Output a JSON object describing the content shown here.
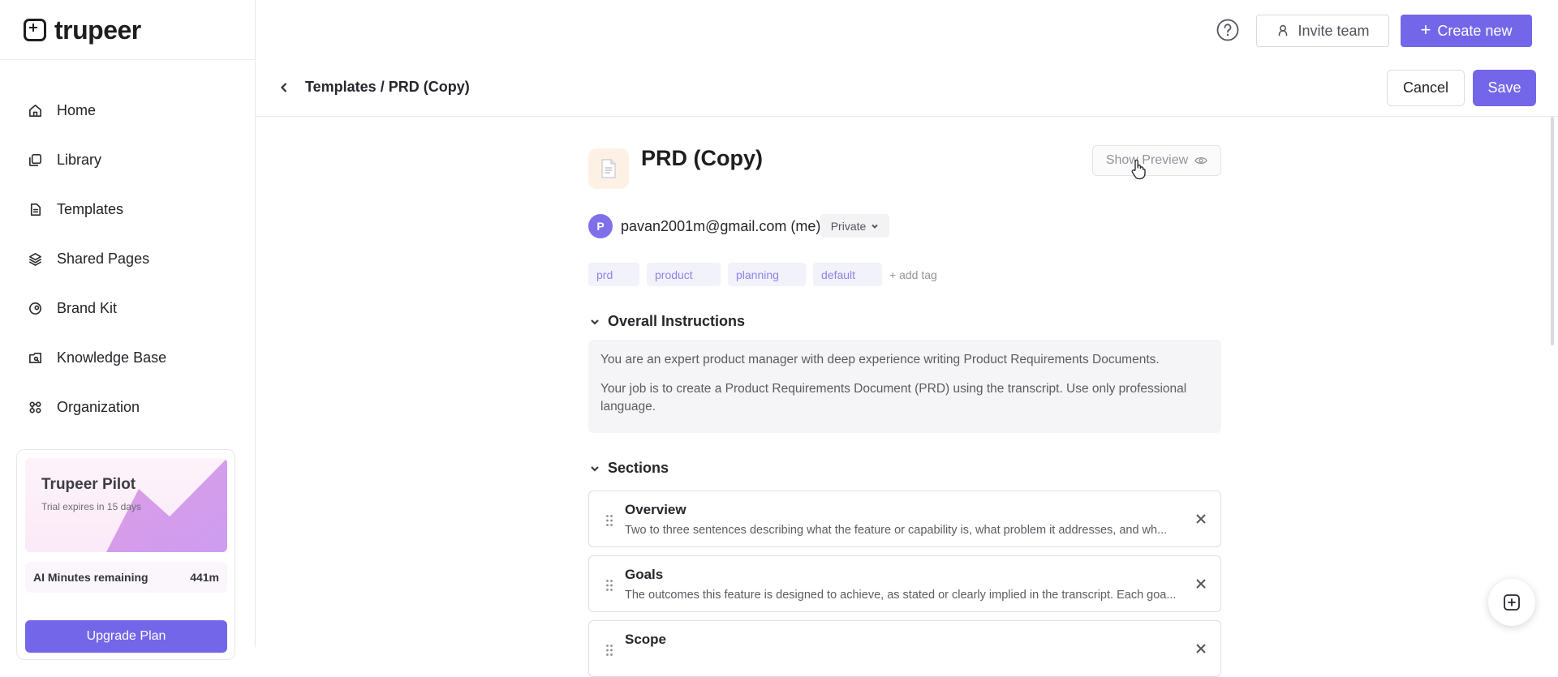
{
  "app": {
    "brand_name": "trupeer",
    "accent_color": "#7366e8"
  },
  "sidebar": {
    "items": [
      {
        "label": "Home",
        "icon": "home-icon"
      },
      {
        "label": "Library",
        "icon": "library-icon"
      },
      {
        "label": "Templates",
        "icon": "templates-icon"
      },
      {
        "label": "Shared Pages",
        "icon": "shared-pages-icon"
      },
      {
        "label": "Brand Kit",
        "icon": "brand-kit-icon"
      },
      {
        "label": "Knowledge Base",
        "icon": "knowledge-base-icon"
      },
      {
        "label": "Organization",
        "icon": "organization-icon"
      }
    ],
    "pilot": {
      "title": "Trupeer Pilot",
      "trial_text": "Trial expires in 15 days",
      "minutes_label": "AI Minutes remaining",
      "minutes_value": "441m",
      "upgrade_label": "Upgrade Plan"
    }
  },
  "topbar": {
    "help_icon": "help-icon",
    "invite_label": "Invite team",
    "create_label": "Create new"
  },
  "header": {
    "breadcrumb": "Templates / PRD (Copy)",
    "cancel_label": "Cancel",
    "save_label": "Save"
  },
  "template": {
    "title": "PRD (Copy)",
    "show_preview_label": "Show Preview",
    "owner_initial": "P",
    "owner_email": "pavan2001m@gmail.com (me)",
    "visibility": "Private",
    "tags": [
      "prd",
      "product",
      "planning",
      "default"
    ],
    "add_tag_label": "+ add tag",
    "instructions_heading": "Overall Instructions",
    "instructions": [
      "You are an expert product manager with deep experience writing Product Requirements Documents.",
      "Your job is to create a Product Requirements Document (PRD) using the transcript. Use only professional language."
    ],
    "sections_heading": "Sections",
    "sections": [
      {
        "title": "Overview",
        "description": "Two to three sentences describing what the feature or capability is, what problem it addresses, and wh..."
      },
      {
        "title": "Goals",
        "description": "The outcomes this feature is designed to achieve, as stated or clearly implied in the transcript. Each goa..."
      },
      {
        "title": "Scope",
        "description": ""
      }
    ]
  }
}
